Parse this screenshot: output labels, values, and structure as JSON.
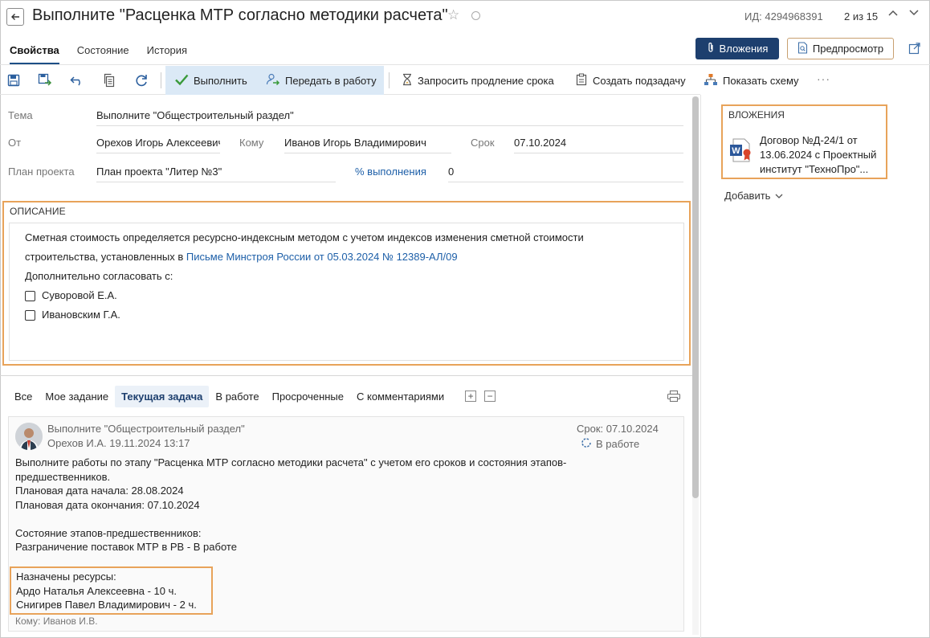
{
  "header": {
    "title": "Выполните \"Расценка МТР согласно методики расчета\"",
    "id_text": "ИД: 4294968391",
    "counter": "2 из 15",
    "icons": [
      "back-arrow-icon",
      "star-icon",
      "circle-icon",
      "chevron-up-icon",
      "chevron-down-icon",
      "popout-icon"
    ]
  },
  "tabs": [
    {
      "label": "Свойства",
      "active": true
    },
    {
      "label": "Состояние",
      "active": false
    },
    {
      "label": "История",
      "active": false
    }
  ],
  "actions": {
    "attachments_label": "Вложения",
    "preview_label": "Предпросмотр"
  },
  "toolbar": {
    "complete": "Выполнить",
    "hand_over": "Передать в работу",
    "request_extension": "Запросить продление срока",
    "create_subtask": "Создать подзадачу",
    "show_scheme": "Показать схему",
    "more": "···"
  },
  "form": {
    "subject_label": "Тема",
    "subject_value": "Выполните \"Общестроительный раздел\"",
    "from_label": "От",
    "from_value": "Орехов Игорь Алексеевич",
    "to_label": "Кому",
    "to_value": "Иванов Игорь Владимирович",
    "due_label": "Срок",
    "due_value": "07.10.2024",
    "plan_label": "План проекта",
    "plan_value": "План проекта \"Литер №3\"",
    "progress_label": "% выполнения",
    "progress_value": "0"
  },
  "description": {
    "heading": "ОПИСАНИЕ",
    "line1": "Сметная стоимость определяется ресурсно-индексным методом с учетом индексов изменения сметной стоимости",
    "line2_prefix": "строительства, установленных в ",
    "link": "Письме Минстроя России от 05.03.2024 № 12389-АЛ/09",
    "line3": "Дополнительно согласовать с:",
    "checkboxes": [
      {
        "label": "Суворовой Е.А.",
        "checked": false
      },
      {
        "label": "Ивановским Г.А.",
        "checked": false
      }
    ]
  },
  "filters": {
    "all": "Все",
    "mine": "Мое задание",
    "current": "Текущая задача",
    "in_progress": "В работе",
    "overdue": "Просроченные",
    "commented": "С комментариями"
  },
  "card": {
    "title": "Выполните \"Общестроительный раздел\"",
    "author_meta": "Орехов И.А.   19.11.2024 13:17",
    "due": "Срок: 07.10.2024",
    "status": "В работе",
    "body": "Выполните работы по этапу \"Расценка МТР согласно методики расчета\" с учетом его сроков и состояния этапов-\nпредшественников.\nПлановая дата начала: 28.08.2024\nПлановая дата окончания: 07.10.2024\n\nСостояние этапов-предшественников:\nРазграничение поставок МТР в РВ  - В работе",
    "resources": "Назначены ресурсы:\nАрдо Наталья Алексеевна - 10 ч.\nСнигирев Павел Владимирович - 2 ч.",
    "recipient": "Кому: Иванов И.В."
  },
  "right_pane": {
    "heading": "ВЛОЖЕНИЯ",
    "file_name": "Договор №Д-24/1 от 13.06.2024 с Проектный институт \"ТехноПро\"...",
    "add_label": "Добавить"
  },
  "colors": {
    "accent": "#1d3f6e",
    "highlight_border": "#e8a35a",
    "link": "#1d5fa8"
  }
}
